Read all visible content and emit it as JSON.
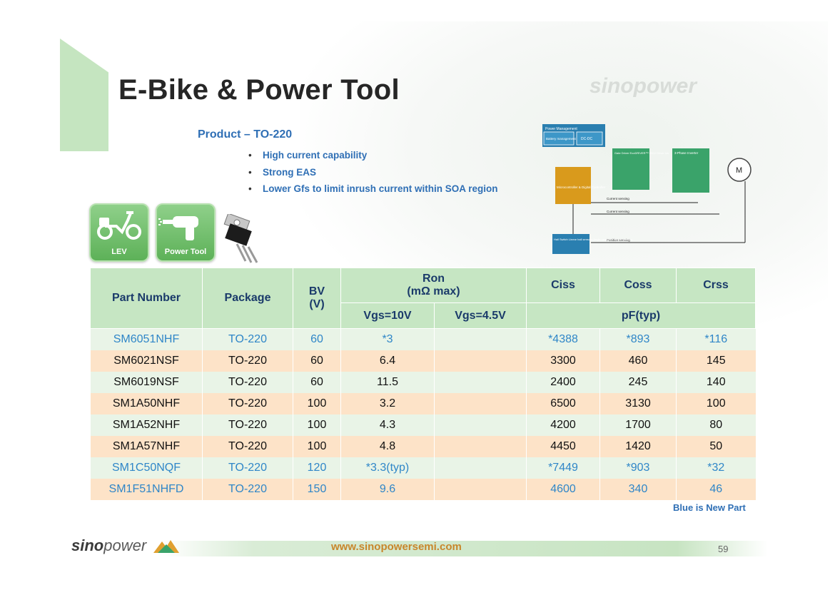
{
  "slide": {
    "title": "E-Bike & Power Tool",
    "product_heading": "Product – TO-220",
    "bullets": [
      "High current capability",
      "Strong EAS",
      "Lower Gfs to limit inrush current  within SOA region"
    ],
    "icons": [
      {
        "label": "LEV",
        "icon": "scooter-icon"
      },
      {
        "label": "Power Tool",
        "icon": "drill-icon"
      }
    ],
    "watermark_logo": "sinopower"
  },
  "diagram": {
    "power_management": "Power Management",
    "battery_management": "Battery management",
    "dc_dc": "DC-DC",
    "gate_driver": "Gate Driver EcoDRIVER™ 200V Driver Ics",
    "three_phase_inverter": "3-Phase Inverter",
    "microcontroller": "Microcontroller & Digital Controller",
    "motor": "M",
    "current_sensing_1": "Current sensing",
    "current_sensing_2": "Current sensing",
    "position_sensing": "Position sensing",
    "hall_switch": "Hall Switch Linear hall sensors Angle sensors Current sensors"
  },
  "table": {
    "headers": {
      "part_number": "Part Number",
      "package": "Package",
      "bv": "BV",
      "bv_unit": "(V)",
      "ron": "Ron",
      "ron_unit": "(mΩ max)",
      "vgs10": "Vgs=10V",
      "vgs45": "Vgs=4.5V",
      "ciss": "Ciss",
      "coss": "Coss",
      "crss": "Crss",
      "pf": "pF(typ)"
    },
    "rows": [
      {
        "part": "SM6051NHF",
        "pkg": "TO-220",
        "bv": "60",
        "ron10": "*3",
        "ron45": "",
        "ciss": "*4388",
        "coss": "*893",
        "crss": "*116",
        "new": true
      },
      {
        "part": "SM6021NSF",
        "pkg": "TO-220",
        "bv": "60",
        "ron10": "6.4",
        "ron45": "",
        "ciss": "3300",
        "coss": "460",
        "crss": "145",
        "new": false
      },
      {
        "part": "SM6019NSF",
        "pkg": "TO-220",
        "bv": "60",
        "ron10": "11.5",
        "ron45": "",
        "ciss": "2400",
        "coss": "245",
        "crss": "140",
        "new": false
      },
      {
        "part": "SM1A50NHF",
        "pkg": "TO-220",
        "bv": "100",
        "ron10": "3.2",
        "ron45": "",
        "ciss": "6500",
        "coss": "3130",
        "crss": "100",
        "new": false
      },
      {
        "part": "SM1A52NHF",
        "pkg": "TO-220",
        "bv": "100",
        "ron10": "4.3",
        "ron45": "",
        "ciss": "4200",
        "coss": "1700",
        "crss": "80",
        "new": false
      },
      {
        "part": "SM1A57NHF",
        "pkg": "TO-220",
        "bv": "100",
        "ron10": "4.8",
        "ron45": "",
        "ciss": "4450",
        "coss": "1420",
        "crss": "50",
        "new": false
      },
      {
        "part": "SM1C50NQF",
        "pkg": "TO-220",
        "bv": "120",
        "ron10": "*3.3(typ)",
        "ron45": "",
        "ciss": "*7449",
        "coss": "*903",
        "crss": "*32",
        "new": true
      },
      {
        "part": "SM1F51NHFD",
        "pkg": "TO-220",
        "bv": "150",
        "ron10": "9.6",
        "ron45": "",
        "ciss": "4600",
        "coss": "340",
        "crss": "46",
        "new": true
      }
    ],
    "note": "Blue is New Part"
  },
  "footer": {
    "logo_bold": "sino",
    "logo_light": "power",
    "url": "www.sinopowersemi.com",
    "page": "59"
  },
  "colors": {
    "accent_blue": "#2f6fb5",
    "new_part_blue": "#2f86c8",
    "header_green": "#c6e6c3",
    "row_orange": "#fde3c8",
    "row_green": "#e9f4e7",
    "url_orange": "#c8862b"
  }
}
